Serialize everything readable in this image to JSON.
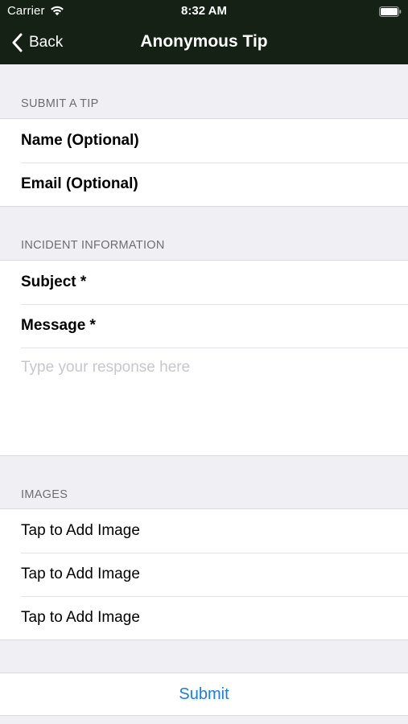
{
  "status_bar": {
    "carrier": "Carrier",
    "time": "8:32 AM",
    "wifi_icon": "wifi-icon",
    "battery_icon": "battery-full-icon"
  },
  "nav": {
    "back_label": "Back",
    "title": "Anonymous Tip",
    "back_icon": "chevron-left-icon",
    "bar_color": "#142114"
  },
  "sections": {
    "submit_tip": {
      "header": "SUBMIT A TIP",
      "name_label": "Name (Optional)",
      "email_label": "Email (Optional)"
    },
    "incident": {
      "header": "INCIDENT INFORMATION",
      "subject_label": "Subject *",
      "message_label": "Message *",
      "message_placeholder": "Type your response here"
    },
    "images": {
      "header": "IMAGES",
      "items": [
        "Tap to Add Image",
        "Tap to Add Image",
        "Tap to Add Image"
      ]
    }
  },
  "submit": {
    "label": "Submit",
    "color": "#1a7ee6"
  }
}
